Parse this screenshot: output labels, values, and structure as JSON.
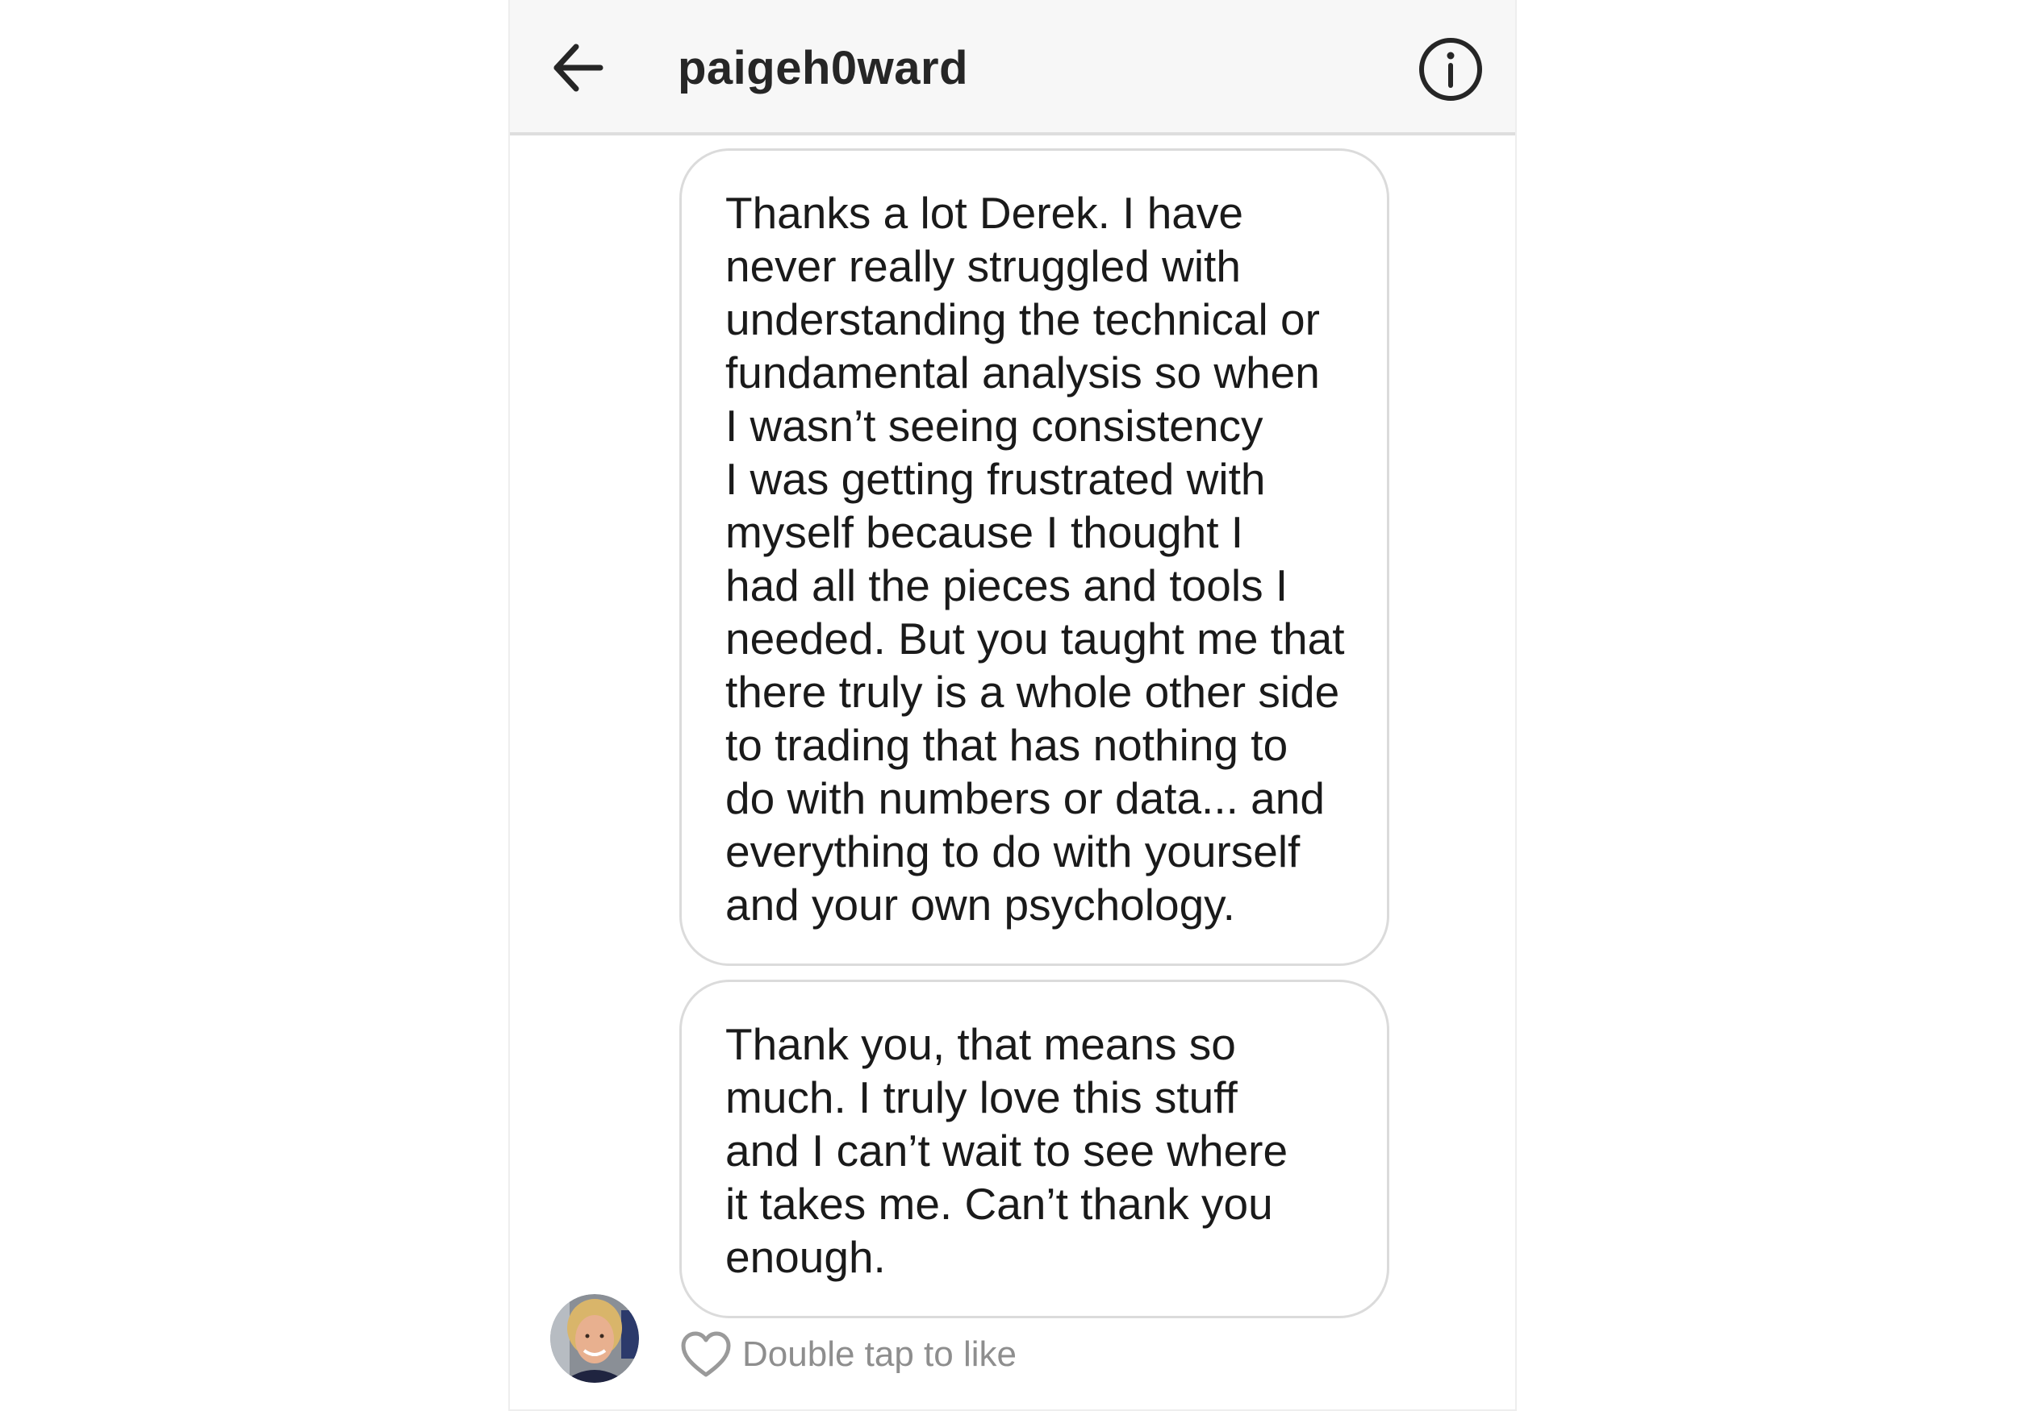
{
  "header": {
    "username": "paigeh0ward",
    "back_icon": "arrow-left-icon",
    "info_icon": "info-circle-icon"
  },
  "messages": [
    {
      "text": "Thanks a lot Derek. I have\nnever really struggled with\nunderstanding the technical or\nfundamental analysis so when\nI wasn’t seeing consistency\nI was getting frustrated with\nmyself because I thought I\nhad all the pieces and tools I\nneeded. But you taught me that\nthere truly is a whole other side\nto trading that has nothing to\ndo with numbers or data... and\neverything to do with yourself\nand your own psychology."
    },
    {
      "text": "Thank you, that means so\nmuch. I truly love this stuff\nand I can’t wait to see where\nit takes me. Can’t thank you\nenough."
    }
  ],
  "footer": {
    "like_hint": "Double tap to like",
    "like_icon": "heart-outline-icon",
    "avatar_icon": "profile-avatar"
  },
  "colors": {
    "header_bg": "#f7f7f7",
    "bubble_border": "#dbdbdb",
    "text": "#262626",
    "muted": "#8e8e8e"
  }
}
